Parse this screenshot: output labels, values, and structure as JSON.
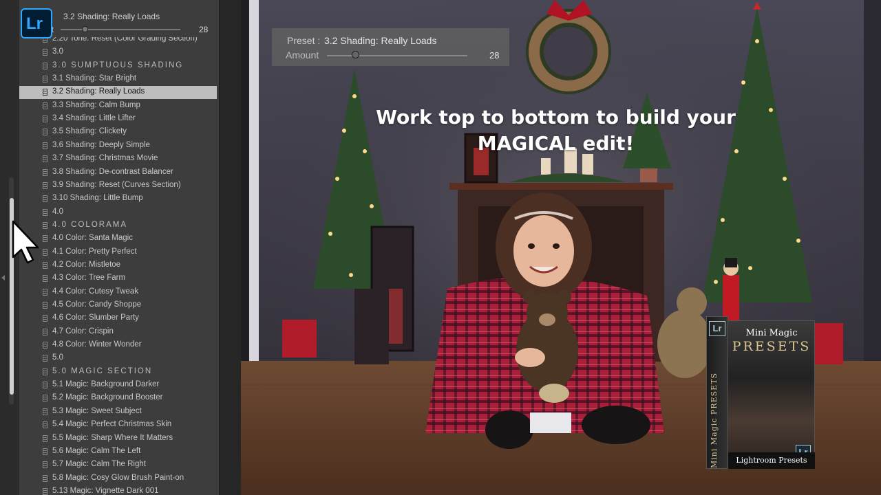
{
  "panel_top": {
    "title": "3.2 Shading:  Really Loads",
    "amount_label": "nt",
    "amount_value": "28",
    "amount_fraction": 0.2
  },
  "logo": {
    "text": "Lr"
  },
  "preset_list": [
    {
      "label": "2.20 Tone: Reset (Color Grading Section)",
      "type": "item"
    },
    {
      "label": "3.0",
      "type": "item"
    },
    {
      "label": "3.0  SUMPTUOUS SHADING",
      "type": "header"
    },
    {
      "label": "3.1  Shading:  Star Bright",
      "type": "item"
    },
    {
      "label": "3.2  Shading:  Really Loads",
      "type": "selected"
    },
    {
      "label": "3.3  Shading:  Calm Bump",
      "type": "item"
    },
    {
      "label": "3.4  Shading:  Little Lifter",
      "type": "item"
    },
    {
      "label": "3.5  Shading:  Clickety",
      "type": "item"
    },
    {
      "label": "3.6  Shading:  Deeply Simple",
      "type": "item"
    },
    {
      "label": "3.7  Shading:  Christmas Movie",
      "type": "item"
    },
    {
      "label": "3.8  Shading:  De-contrast Balancer",
      "type": "item"
    },
    {
      "label": "3.9  Shading:  Reset (Curves Section)",
      "type": "item"
    },
    {
      "label": "3.10 Shading: Little Bump",
      "type": "item"
    },
    {
      "label": "4.0",
      "type": "item"
    },
    {
      "label": "4.0  COLORAMA",
      "type": "header"
    },
    {
      "label": "4.0  Color: Santa Magic",
      "type": "item"
    },
    {
      "label": "4.1  Color: Pretty Perfect",
      "type": "item"
    },
    {
      "label": "4.2  Color: Mistletoe",
      "type": "item"
    },
    {
      "label": "4.3  Color: Tree Farm",
      "type": "item"
    },
    {
      "label": "4.4  Color: Cutesy Tweak",
      "type": "item"
    },
    {
      "label": "4.5  Color: Candy Shoppe",
      "type": "item"
    },
    {
      "label": "4.6 Color: Slumber Party",
      "type": "item"
    },
    {
      "label": "4.7  Color: Crispin",
      "type": "item"
    },
    {
      "label": "4.8  Color: Winter Wonder",
      "type": "item"
    },
    {
      "label": "5.0",
      "type": "item"
    },
    {
      "label": "5.0  MAGIC SECTION",
      "type": "header"
    },
    {
      "label": "5.1  Magic: Background Darker",
      "type": "item"
    },
    {
      "label": "5.2  Magic: Background Booster",
      "type": "item"
    },
    {
      "label": "5.3  Magic: Sweet Subject",
      "type": "item"
    },
    {
      "label": "5.4  Magic: Perfect Christmas Skin",
      "type": "item"
    },
    {
      "label": "5.5  Magic: Sharp Where It Matters",
      "type": "item"
    },
    {
      "label": "5.6  Magic: Calm The Left",
      "type": "item"
    },
    {
      "label": "5.7  Magic: Calm The Right",
      "type": "item"
    },
    {
      "label": "5.8 Magic: Cosy Glow Brush Paint-on",
      "type": "item"
    },
    {
      "label": "5.13 Magic: Vignette Dark 001",
      "type": "item"
    }
  ],
  "photo_overlay": {
    "preset_key": "Preset :",
    "preset_value": "3.2 Shading:  Really Loads",
    "amount_label": "Amount",
    "amount_value": "28",
    "amount_fraction": 0.2
  },
  "caption": {
    "line1": "Work top to bottom to build your",
    "line2": "MAGICAL edit!"
  },
  "product_box": {
    "mini": "Mini Magic",
    "presets": "PRESETS",
    "side_text": "Mini Magic PRESETS",
    "bottom": "Lightroom Presets",
    "badge": "Lr"
  },
  "colors": {
    "panel_bg": "#3d3d3d",
    "selected_row": "#bdbdbd",
    "lr_blue": "#31a8ff",
    "lr_dark": "#001d34"
  }
}
